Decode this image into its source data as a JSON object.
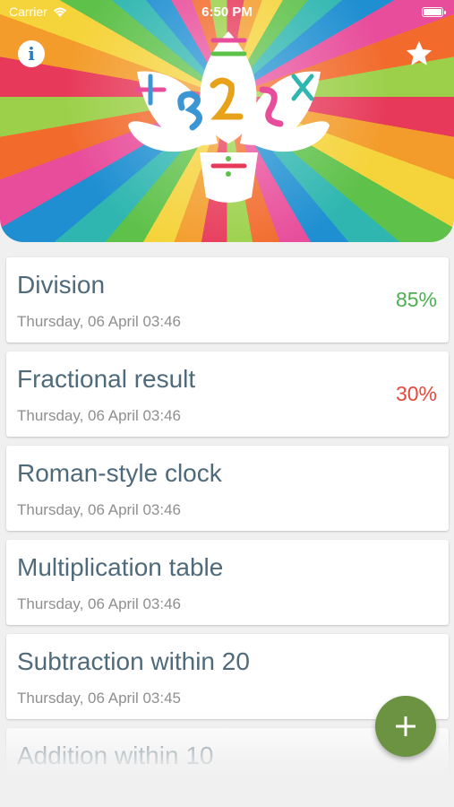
{
  "status_bar": {
    "carrier": "Carrier",
    "time": "6:50 PM"
  },
  "header": {
    "info_icon": "info-icon",
    "favorites_icon": "star-icon",
    "logo": "math-lotus-logo"
  },
  "exercises": [
    {
      "title": "Division",
      "date": "Thursday, 06 April 03:46",
      "score": "85%",
      "score_color": "#4caf50"
    },
    {
      "title": "Fractional result",
      "date": "Thursday, 06 April 03:46",
      "score": "30%",
      "score_color": "#e8473b"
    },
    {
      "title": "Roman-style clock",
      "date": "Thursday, 06 April 03:46",
      "score": "",
      "score_color": ""
    },
    {
      "title": "Multiplication table",
      "date": "Thursday, 06 April 03:46",
      "score": "",
      "score_color": ""
    },
    {
      "title": "Subtraction within 20",
      "date": "Thursday, 06 April 03:45",
      "score": "",
      "score_color": ""
    },
    {
      "title": "Addition within 10",
      "date": "",
      "score": "",
      "score_color": ""
    }
  ],
  "fab": {
    "icon": "plus-icon",
    "color": "#6b9341"
  }
}
